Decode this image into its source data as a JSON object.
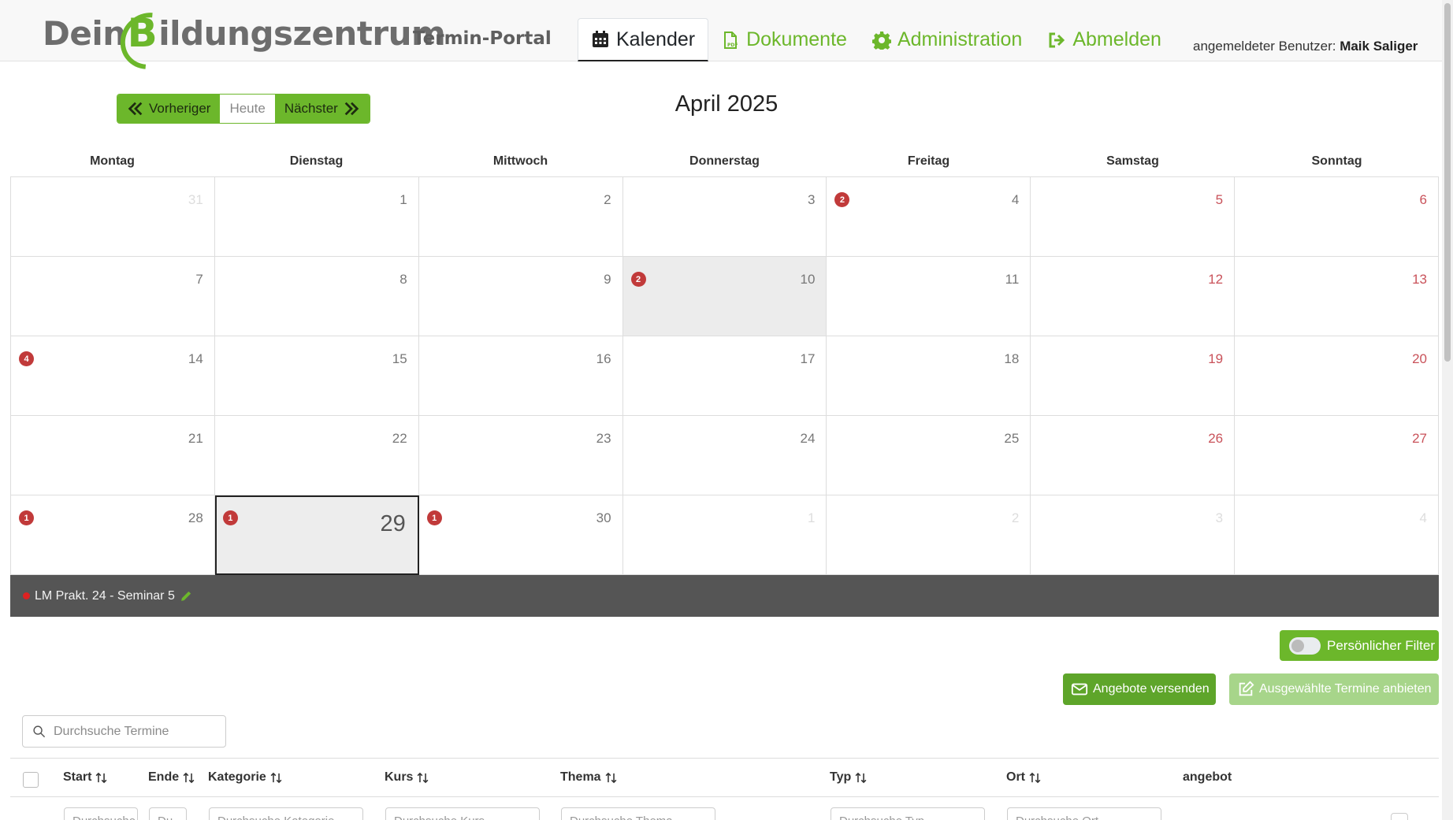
{
  "header": {
    "logo_pre": "Dein",
    "logo_b": "B",
    "logo_post": "ildungszentrum",
    "portal": "Termin-Portal",
    "nav": [
      {
        "label": "Kalender",
        "icon": "calendar-icon",
        "active": true
      },
      {
        "label": "Dokumente",
        "icon": "pdf-file-icon",
        "active": false
      },
      {
        "label": "Administration",
        "icon": "gear-icon",
        "active": false
      },
      {
        "label": "Abmelden",
        "icon": "sign-out-icon",
        "active": false
      }
    ],
    "user_label": "angemeldeter Benutzer:",
    "user_name": "Maik Saliger"
  },
  "calendar": {
    "prev": "Vorheriger",
    "today": "Heute",
    "next": "Nächster",
    "month": "April 2025",
    "weekdays": [
      "Montag",
      "Dienstag",
      "Mittwoch",
      "Donnerstag",
      "Freitag",
      "Samstag",
      "Sonntag"
    ],
    "days": [
      {
        "n": "31",
        "other": true
      },
      {
        "n": "1"
      },
      {
        "n": "2"
      },
      {
        "n": "3"
      },
      {
        "n": "4",
        "badge": "2"
      },
      {
        "n": "5",
        "we": true
      },
      {
        "n": "6",
        "we": true
      },
      {
        "n": "7"
      },
      {
        "n": "8"
      },
      {
        "n": "9"
      },
      {
        "n": "10",
        "badge": "2",
        "hl": true
      },
      {
        "n": "11"
      },
      {
        "n": "12",
        "we": true
      },
      {
        "n": "13",
        "we": true
      },
      {
        "n": "14",
        "badge": "4"
      },
      {
        "n": "15"
      },
      {
        "n": "16"
      },
      {
        "n": "17"
      },
      {
        "n": "18"
      },
      {
        "n": "19",
        "we": true
      },
      {
        "n": "20",
        "we": true
      },
      {
        "n": "21"
      },
      {
        "n": "22"
      },
      {
        "n": "23"
      },
      {
        "n": "24"
      },
      {
        "n": "25"
      },
      {
        "n": "26",
        "we": true
      },
      {
        "n": "27",
        "we": true
      },
      {
        "n": "28",
        "badge": "1"
      },
      {
        "n": "29",
        "badge": "1",
        "selected": true
      },
      {
        "n": "30",
        "badge": "1"
      },
      {
        "n": "1",
        "other": true
      },
      {
        "n": "2",
        "other": true
      },
      {
        "n": "3",
        "other": true
      },
      {
        "n": "4",
        "other": true
      }
    ],
    "selected_event": "LM Prakt. 24 - Seminar 5"
  },
  "actions": {
    "filter": "Persönlicher Filter",
    "send": "Angebote versenden",
    "offer": "Ausgewählte Termine anbieten",
    "search_placeholder": "Durchsuche Termine"
  },
  "table": {
    "columns": [
      "Start",
      "Ende",
      "Kategorie",
      "Kurs",
      "Thema",
      "Typ",
      "Ort",
      "angebot"
    ],
    "filter_placeholders": [
      "Durchsuche",
      "Du",
      "Durchsuche Kategorie",
      "Durchsuche Kurs",
      "Durchsuche Thema",
      "Durchsuche Typ",
      "Durchsuche Ort"
    ]
  },
  "colors": {
    "brand": "#6cb72b",
    "badge": "#c13a3a",
    "weekend": "#c9525a"
  }
}
